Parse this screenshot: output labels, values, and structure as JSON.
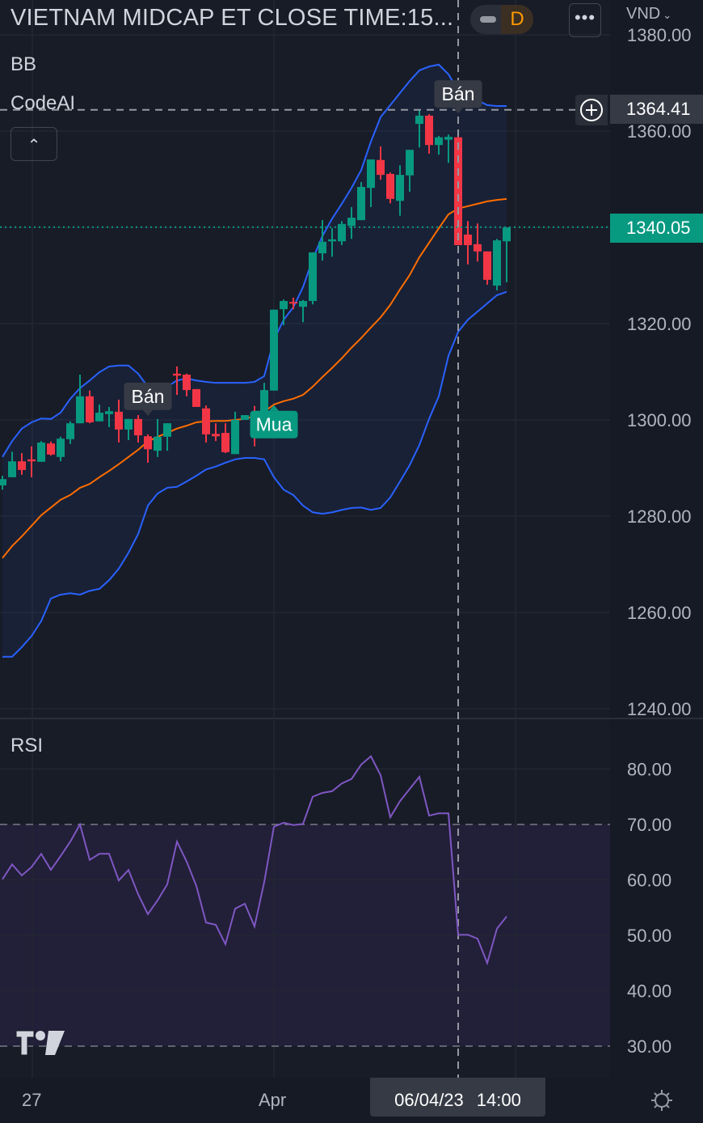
{
  "header": {
    "title": "VIETNAM MIDCAP ET CLOSE TIME:15...",
    "interval": "D",
    "more_label": "•••",
    "currency": "VND"
  },
  "legend": {
    "bb": "BB",
    "codeai": "CodeAI",
    "rsi": "RSI",
    "collapse_icon": "chevron-up-icon"
  },
  "price_tags": {
    "crosshair_price": "1364.41",
    "last_price": "1340.05"
  },
  "time_axis": {
    "labels": [
      "27",
      "Apr"
    ],
    "crosshair_date": "06/04/23",
    "crosshair_time": "14:00"
  },
  "colors": {
    "bg": "#161a25",
    "up": "#089981",
    "down": "#f23645",
    "bb_band": "#2962ff",
    "bb_basis": "#ff6d00",
    "rsi": "#7e57c2",
    "grid": "#232733"
  },
  "chart_data": [
    {
      "type": "candlestick",
      "title": "VIETNAM MIDCAP ET CLOSE TIME:15...",
      "y_ticks": [
        "1380.00",
        "1360.00",
        "1340.00",
        "1320.00",
        "1300.00",
        "1280.00",
        "1260.00",
        "1240.00"
      ],
      "ylim": [
        1238,
        1388
      ],
      "candles_ohlc": [
        [
          1286.4,
          1288.4,
          1285.5,
          1287.7
        ],
        [
          1288.1,
          1293.4,
          1288.1,
          1291.4
        ],
        [
          1291.4,
          1293.1,
          1288.6,
          1289.6
        ],
        [
          1291.8,
          1294.5,
          1288.1,
          1291.4
        ],
        [
          1291.3,
          1295.6,
          1291.3,
          1295.3
        ],
        [
          1295.1,
          1295.5,
          1292.6,
          1292.8
        ],
        [
          1292.3,
          1296.5,
          1291.4,
          1296.1
        ],
        [
          1296.0,
          1299.7,
          1295.0,
          1299.3
        ],
        [
          1299.3,
          1309.4,
          1299.3,
          1304.9
        ],
        [
          1304.9,
          1306.1,
          1299.3,
          1299.5
        ],
        [
          1299.7,
          1303.2,
          1299.7,
          1301.5
        ],
        [
          1301.2,
          1302.7,
          1298.5,
          1301.8
        ],
        [
          1301.7,
          1304.2,
          1295.3,
          1298.0
        ],
        [
          1298.0,
          1300.2,
          1295.8,
          1300.2
        ],
        [
          1300.2,
          1301.0,
          1295.3,
          1296.8
        ],
        [
          1296.6,
          1297.0,
          1291.1,
          1293.9
        ],
        [
          1293.6,
          1300.2,
          1292.3,
          1296.5
        ],
        [
          1296.5,
          1299.3,
          1293.6,
          1299.3
        ],
        [
          1309.6,
          1311.1,
          1305.2,
          1309.2
        ],
        [
          1309.4,
          1309.6,
          1304.9,
          1306.2
        ],
        [
          1306.4,
          1306.4,
          1302.7,
          1302.7
        ],
        [
          1302.4,
          1303.0,
          1295.3,
          1297.0
        ],
        [
          1297.1,
          1299.3,
          1295.6,
          1296.6
        ],
        [
          1297.3,
          1299.3,
          1293.1,
          1293.3
        ],
        [
          1292.9,
          1301.7,
          1292.9,
          1300.0
        ],
        [
          1300.0,
          1301.0,
          1300.0,
          1301.0
        ],
        [
          1300.7,
          1302.9,
          1294.5,
          1299.8
        ],
        [
          1301.8,
          1307.7,
          1301.8,
          1306.2
        ],
        [
          1306.1,
          1322.9,
          1306.1,
          1322.9
        ],
        [
          1323.0,
          1325.0,
          1319.7,
          1324.7
        ],
        [
          1324.5,
          1325.4,
          1323.0,
          1324.2
        ],
        [
          1323.5,
          1324.9,
          1320.3,
          1324.7
        ],
        [
          1324.7,
          1334.8,
          1324.0,
          1334.8
        ],
        [
          1334.6,
          1341.5,
          1333.1,
          1337.0
        ],
        [
          1337.1,
          1339.8,
          1333.9,
          1337.5
        ],
        [
          1337.1,
          1341.3,
          1336.3,
          1340.7
        ],
        [
          1340.3,
          1344.2,
          1337.6,
          1342.0
        ],
        [
          1341.5,
          1349.4,
          1341.5,
          1348.4
        ],
        [
          1348.2,
          1354.1,
          1344.2,
          1354.1
        ],
        [
          1354.0,
          1356.8,
          1349.9,
          1350.9
        ],
        [
          1351.1,
          1351.4,
          1345.0,
          1345.9
        ],
        [
          1345.5,
          1352.9,
          1342.4,
          1350.9
        ],
        [
          1350.8,
          1356.1,
          1347.4,
          1356.1
        ],
        [
          1361.5,
          1364.4,
          1356.6,
          1363.2
        ],
        [
          1363.2,
          1363.5,
          1355.3,
          1357.1
        ],
        [
          1357.1,
          1359.0,
          1355.1,
          1358.7
        ],
        [
          1358.2,
          1359.3,
          1353.4,
          1358.8
        ],
        [
          1358.7,
          1359.8,
          1336.3,
          1336.3
        ],
        [
          1338.5,
          1341.3,
          1332.3,
          1336.3
        ],
        [
          1336.5,
          1340.8,
          1332.9,
          1335.0
        ],
        [
          1335.0,
          1335.0,
          1328.1,
          1329.1
        ],
        [
          1327.9,
          1337.6,
          1326.9,
          1337.3
        ],
        [
          1337.1,
          1340.0,
          1328.6,
          1340.0
        ]
      ],
      "bb_upper": [
        1292.3,
        1295.6,
        1298.2,
        1299.5,
        1300.3,
        1300.2,
        1301.5,
        1304.4,
        1306.6,
        1308.2,
        1309.9,
        1311.1,
        1311.3,
        1311.3,
        1309.6,
        1306.9,
        1306.6,
        1306.9,
        1308.2,
        1308.6,
        1308.2,
        1307.9,
        1307.7,
        1307.7,
        1307.7,
        1307.7,
        1307.9,
        1309.1,
        1316.6,
        1320.8,
        1323.4,
        1327.6,
        1333.4,
        1338.2,
        1341.8,
        1344.9,
        1348.2,
        1351.9,
        1357.8,
        1362.9,
        1365.4,
        1367.9,
        1370.4,
        1372.6,
        1373.4,
        1373.8,
        1371.8,
        1368.4,
        1367.1,
        1366.4,
        1365.4,
        1365.2,
        1365.2
      ],
      "bb_basis": [
        1271.3,
        1273.8,
        1275.8,
        1278.0,
        1280.2,
        1281.8,
        1283.4,
        1284.4,
        1285.9,
        1286.7,
        1288.1,
        1289.4,
        1290.8,
        1292.3,
        1293.8,
        1295.5,
        1296.5,
        1297.3,
        1298.2,
        1298.8,
        1299.5,
        1299.7,
        1299.8,
        1299.8,
        1300.0,
        1300.2,
        1300.8,
        1301.7,
        1303.2,
        1303.9,
        1304.4,
        1305.2,
        1306.9,
        1308.9,
        1310.8,
        1312.8,
        1315.0,
        1317.0,
        1319.2,
        1321.3,
        1323.9,
        1327.1,
        1330.1,
        1333.8,
        1336.8,
        1339.8,
        1342.7,
        1343.9,
        1344.4,
        1344.9,
        1345.4,
        1345.7,
        1345.9
      ],
      "bb_lower": [
        1250.8,
        1250.8,
        1252.8,
        1255.1,
        1258.2,
        1262.9,
        1263.7,
        1264.0,
        1263.7,
        1264.5,
        1264.9,
        1266.7,
        1269.1,
        1272.4,
        1276.3,
        1282.2,
        1284.7,
        1285.9,
        1286.1,
        1287.2,
        1288.4,
        1289.7,
        1290.3,
        1291.1,
        1291.8,
        1292.1,
        1292.1,
        1291.8,
        1288.1,
        1285.5,
        1284.4,
        1282.2,
        1280.8,
        1280.5,
        1280.8,
        1281.3,
        1281.7,
        1281.8,
        1281.3,
        1281.7,
        1283.9,
        1287.2,
        1290.6,
        1294.8,
        1300.2,
        1304.9,
        1313.3,
        1318.3,
        1320.8,
        1322.5,
        1324.2,
        1325.9,
        1326.6
      ],
      "signals": [
        {
          "index": 15,
          "label": "Bán",
          "side": "sell"
        },
        {
          "index": 28,
          "label": "Mua",
          "side": "buy"
        },
        {
          "index": 47,
          "label": "Bán",
          "side": "sell"
        }
      ],
      "crosshair_index": 47,
      "crosshair_price": 1364.41,
      "last_price": 1340.05
    },
    {
      "type": "line",
      "title": "RSI",
      "y_ticks": [
        "80.00",
        "70.00",
        "60.00",
        "50.00",
        "40.00",
        "30.00"
      ],
      "ylim": [
        20.8,
        89.2
      ],
      "band": [
        30,
        70
      ],
      "values": [
        60.1,
        62.8,
        60.8,
        62.3,
        64.7,
        61.8,
        64.3,
        66.9,
        70.0,
        63.6,
        64.7,
        64.7,
        59.9,
        61.8,
        57.4,
        53.8,
        56.3,
        59.2,
        66.9,
        63.3,
        58.9,
        52.3,
        51.9,
        48.4,
        54.8,
        55.7,
        51.6,
        59.6,
        69.6,
        70.3,
        69.9,
        70.1,
        75.0,
        75.7,
        76.0,
        77.4,
        78.2,
        80.8,
        82.3,
        78.9,
        71.3,
        74.2,
        76.4,
        78.6,
        71.6,
        72.0,
        72.0,
        50.1,
        50.1,
        49.4,
        45.0,
        51.2,
        53.4
      ]
    }
  ]
}
